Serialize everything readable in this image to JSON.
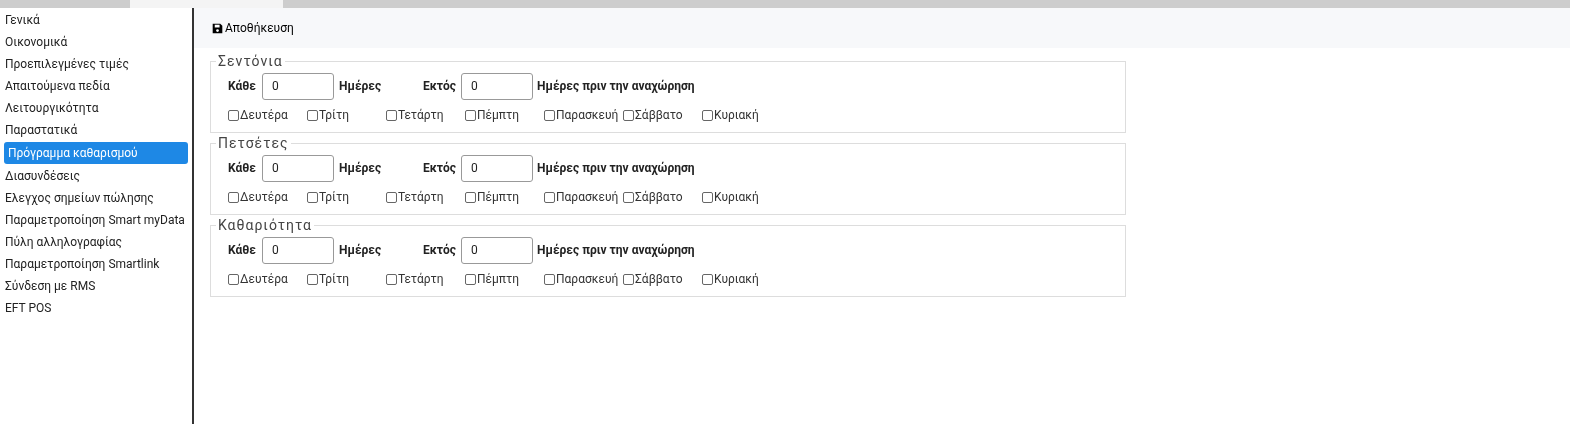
{
  "sidebar": {
    "items": [
      {
        "label": "Γενικά",
        "selected": false
      },
      {
        "label": "Οικονομικά",
        "selected": false
      },
      {
        "label": "Προεπιλεγμένες τιμές",
        "selected": false
      },
      {
        "label": "Απαιτούμενα πεδία",
        "selected": false
      },
      {
        "label": "Λειτουργικότητα",
        "selected": false
      },
      {
        "label": "Παραστατικά",
        "selected": false
      },
      {
        "label": "Πρόγραμμα καθαρισμού",
        "selected": true
      },
      {
        "label": "Διασυνδέσεις",
        "selected": false
      },
      {
        "label": "Ελεγχος σημείων πώλησης",
        "selected": false
      },
      {
        "label": "Παραμετροποίηση Smart myData",
        "selected": false
      },
      {
        "label": "Πύλη αλληλογραφίας",
        "selected": false
      },
      {
        "label": "Παραμετροποίηση Smartlink",
        "selected": false
      },
      {
        "label": "Σύνδεση με RMS",
        "selected": false
      },
      {
        "label": "EFT POS",
        "selected": false
      }
    ]
  },
  "toolbar": {
    "save_button": "Αποθήκευση"
  },
  "sections": [
    {
      "title": "Σεντόνια",
      "every_label": "Κάθε",
      "every_value": "0",
      "every_unit": "Ημέρες",
      "except_label": "Εκτός",
      "except_value": "0",
      "except_unit": "Ημέρες πριν την αναχώρηση",
      "days": [
        {
          "label": "Δευτέρα",
          "checked": false
        },
        {
          "label": "Τρίτη",
          "checked": false
        },
        {
          "label": "Τετάρτη",
          "checked": false
        },
        {
          "label": "Πέμπτη",
          "checked": false
        },
        {
          "label": "Παρασκευή",
          "checked": false
        },
        {
          "label": "Σάββατο",
          "checked": false
        },
        {
          "label": "Κυριακή",
          "checked": false
        }
      ]
    },
    {
      "title": "Πετσέτες",
      "every_label": "Κάθε",
      "every_value": "0",
      "every_unit": "Ημέρες",
      "except_label": "Εκτός",
      "except_value": "0",
      "except_unit": "Ημέρες πριν την αναχώρηση",
      "days": [
        {
          "label": "Δευτέρα",
          "checked": false
        },
        {
          "label": "Τρίτη",
          "checked": false
        },
        {
          "label": "Τετάρτη",
          "checked": false
        },
        {
          "label": "Πέμπτη",
          "checked": false
        },
        {
          "label": "Παρασκευή",
          "checked": false
        },
        {
          "label": "Σάββατο",
          "checked": false
        },
        {
          "label": "Κυριακή",
          "checked": false
        }
      ]
    },
    {
      "title": "Καθαριότητα",
      "every_label": "Κάθε",
      "every_value": "0",
      "every_unit": "Ημέρες",
      "except_label": "Εκτός",
      "except_value": "0",
      "except_unit": "Ημέρες πριν την αναχώρηση",
      "days": [
        {
          "label": "Δευτέρα",
          "checked": false
        },
        {
          "label": "Τρίτη",
          "checked": false
        },
        {
          "label": "Τετάρτη",
          "checked": false
        },
        {
          "label": "Πέμπτη",
          "checked": false
        },
        {
          "label": "Παρασκευή",
          "checked": false
        },
        {
          "label": "Σάββατο",
          "checked": false
        },
        {
          "label": "Κυριακή",
          "checked": false
        }
      ]
    }
  ]
}
